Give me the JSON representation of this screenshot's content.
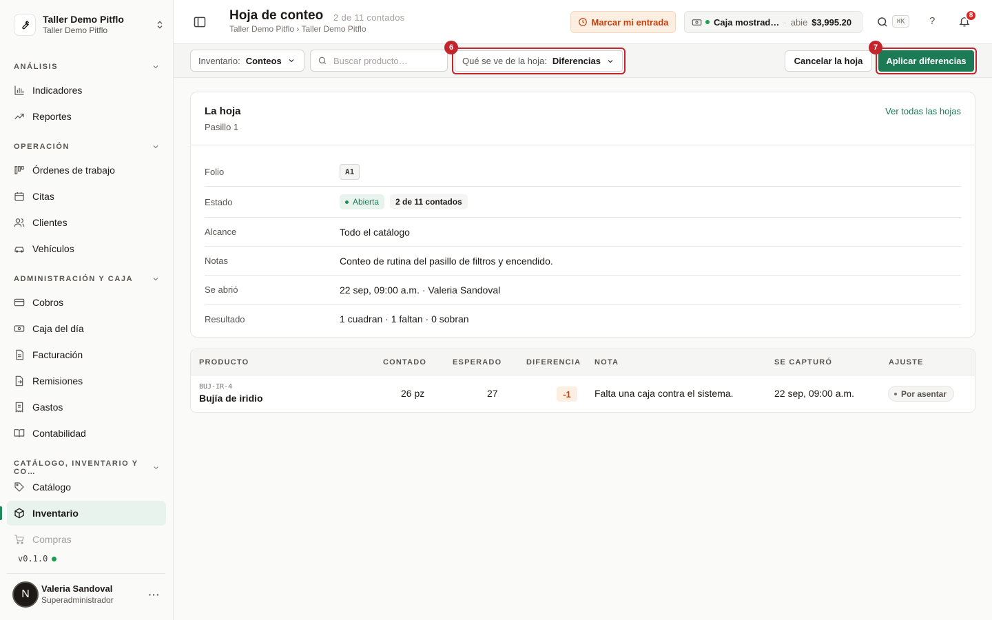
{
  "org": {
    "name": "Taller Demo Pitflo",
    "sub": "Taller Demo Pitflo"
  },
  "sidebar": {
    "sections": [
      {
        "label": "ANÁLISIS"
      },
      {
        "label": "OPERACIÓN"
      },
      {
        "label": "ADMINISTRACIÓN Y CAJA"
      },
      {
        "label": "CATÁLOGO, INVENTARIO Y CO…"
      }
    ],
    "items": [
      {
        "label": "Indicadores",
        "icon": "bar-chart-icon"
      },
      {
        "label": "Reportes",
        "icon": "trend-icon"
      },
      {
        "label": "Órdenes de trabajo",
        "icon": "kanban-icon"
      },
      {
        "label": "Citas",
        "icon": "calendar-icon"
      },
      {
        "label": "Clientes",
        "icon": "users-icon"
      },
      {
        "label": "Vehículos",
        "icon": "car-icon"
      },
      {
        "label": "Cobros",
        "icon": "card-icon"
      },
      {
        "label": "Caja del día",
        "icon": "cash-icon"
      },
      {
        "label": "Facturación",
        "icon": "file-icon"
      },
      {
        "label": "Remisiones",
        "icon": "file-arrow-icon"
      },
      {
        "label": "Gastos",
        "icon": "receipt-icon"
      },
      {
        "label": "Contabilidad",
        "icon": "book-icon"
      },
      {
        "label": "Catálogo",
        "icon": "tag-icon"
      },
      {
        "label": "Inventario",
        "icon": "box-icon",
        "active": true
      },
      {
        "label": "Compras",
        "icon": "cart-icon"
      }
    ],
    "version": "v0.1.0"
  },
  "user": {
    "initial": "N",
    "name": "Valeria Sandoval",
    "role": "Superadministrador",
    "more": "···"
  },
  "header": {
    "title": "Hoja de conteo",
    "count": "2 de 11 contados",
    "breadcrumb": "Taller Demo Pitflo › Taller Demo Pitflo",
    "entry_button": "Marcar mi entrada",
    "caja_name": "Caja mostrad…",
    "caja_sep": "·",
    "caja_status": "abie",
    "caja_amount": "$3,995.20",
    "shortcut": "⌘K",
    "help": "?",
    "notifications": "8"
  },
  "toolbar": {
    "inventory_label": "Inventario:",
    "inventory_value": "Conteos",
    "search_placeholder": "Buscar producto…",
    "view_label": "Qué se ve de la hoja:",
    "view_value": "Diferencias",
    "step_view": "6",
    "step_apply": "7",
    "cancel": "Cancelar la hoja",
    "apply": "Aplicar diferencias"
  },
  "sheet": {
    "title": "La hoja",
    "subtitle": "Pasillo 1",
    "link": "Ver todas las hojas",
    "rows": [
      {
        "key": "Folio",
        "value": "A1"
      },
      {
        "key": "Estado",
        "value": "Abierta",
        "extra": "2 de 11 contados"
      },
      {
        "key": "Alcance",
        "value": "Todo el catálogo"
      },
      {
        "key": "Notas",
        "value": "Conteo de rutina del pasillo de filtros y encendido."
      },
      {
        "key": "Se abrió",
        "value": "22 sep, 09:00 a.m. · Valeria Sandoval"
      },
      {
        "key": "Resultado",
        "value": "1 cuadran · 1 faltan · 0 sobran"
      }
    ]
  },
  "table": {
    "headers": [
      "PRODUCTO",
      "CONTADO",
      "ESPERADO",
      "DIFERENCIA",
      "NOTA",
      "SE CAPTURÓ",
      "AJUSTE"
    ],
    "rows": [
      {
        "sku": "BUJ-IR-4",
        "name": "Bujía de iridio",
        "counted": "26 pz",
        "expected": "27",
        "diff": "-1",
        "note": "Falta una caja contra el sistema.",
        "captured": "22 sep, 09:00 a.m.",
        "adjust": "Por asentar"
      }
    ]
  },
  "colors": {
    "accent": "#1c7a54",
    "highlight": "#c4242b",
    "warning": "#c2410c"
  }
}
